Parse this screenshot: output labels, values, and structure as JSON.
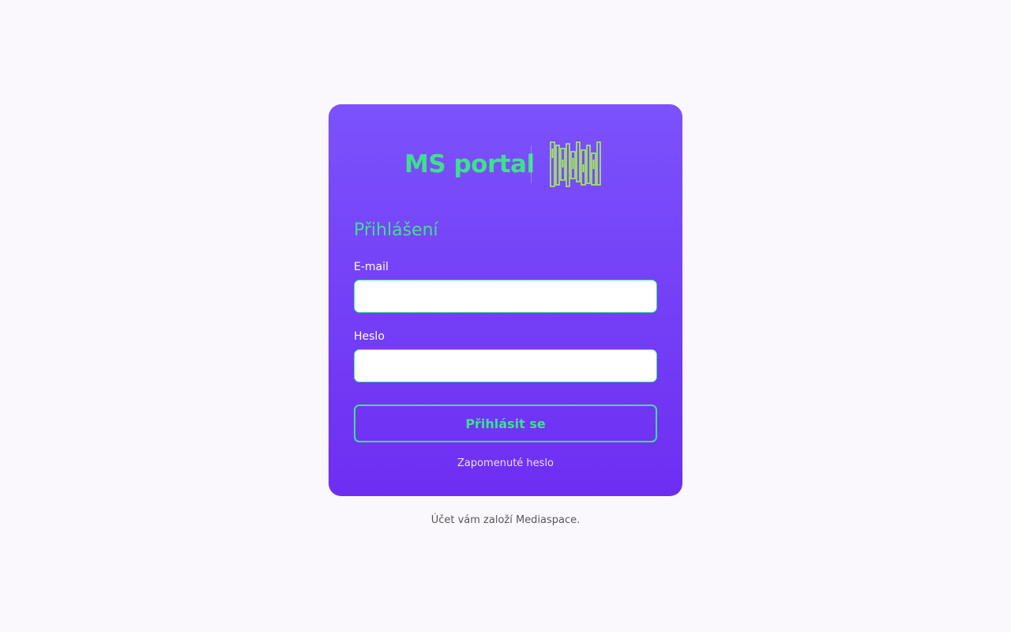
{
  "brand": {
    "title": "MS portal",
    "logo_icon": "mediaspace-logo-icon",
    "logo_color": "#a6f25a"
  },
  "login": {
    "heading": "Přihlášení",
    "email_label": "E-mail",
    "email_value": "",
    "password_label": "Heslo",
    "password_value": "",
    "submit_label": "Přihlásit se",
    "forgot_label": "Zapomenuté heslo"
  },
  "footer": {
    "note": "Účet vám založí Mediaspace."
  },
  "colors": {
    "page_background": "#fbf8fd",
    "card_gradient_top": "#7b52fc",
    "card_gradient_bottom": "#6e2ef2",
    "accent_green": "#3ee08e"
  }
}
